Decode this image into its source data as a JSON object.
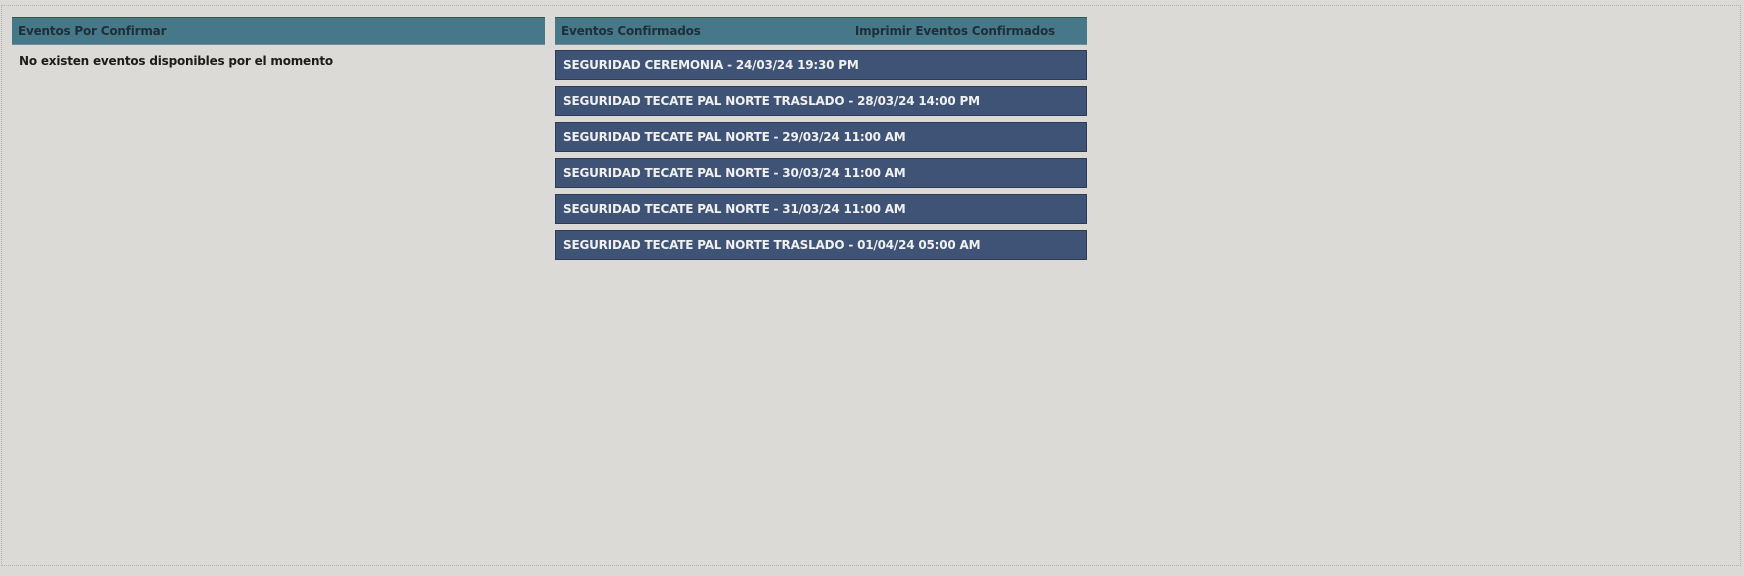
{
  "pending": {
    "title": "Eventos Por Confirmar",
    "empty_message": "No existen eventos disponibles por el momento"
  },
  "confirmed": {
    "title": "Eventos Confirmados",
    "print_label": "Imprimir Eventos Confirmados",
    "events": [
      "SEGURIDAD CEREMONIA - 24/03/24 19:30 PM",
      "SEGURIDAD TECATE PAL NORTE TRASLADO - 28/03/24 14:00 PM",
      "SEGURIDAD TECATE PAL NORTE - 29/03/24 11:00 AM",
      "SEGURIDAD TECATE PAL NORTE - 30/03/24 11:00 AM",
      "SEGURIDAD TECATE PAL NORTE - 31/03/24 11:00 AM",
      "SEGURIDAD TECATE PAL NORTE TRASLADO - 01/04/24 05:00 AM"
    ]
  },
  "colors": {
    "header_bg": "#47788a",
    "event_bg": "#3f5376",
    "page_bg": "#dcdad6"
  }
}
